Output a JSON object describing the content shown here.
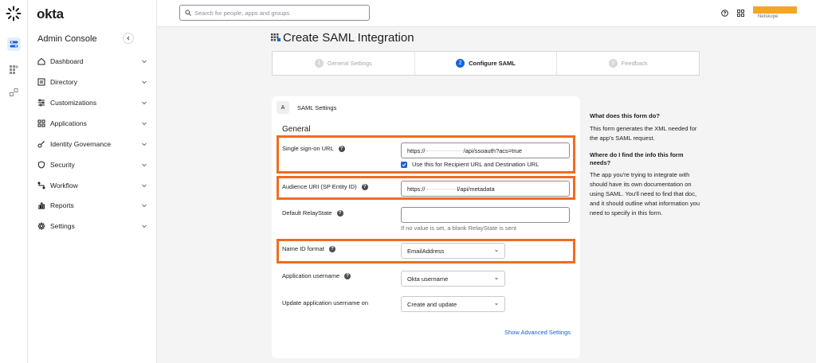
{
  "topbar": {
    "search_placeholder": "Search for people, apps and groups",
    "org_name": "Netskope"
  },
  "sidenav": {
    "brand": "okta",
    "console_title": "Admin Console",
    "items": [
      {
        "label": "Dashboard",
        "icon": "home-icon"
      },
      {
        "label": "Directory",
        "icon": "directory-icon"
      },
      {
        "label": "Customizations",
        "icon": "customizations-icon"
      },
      {
        "label": "Applications",
        "icon": "applications-icon"
      },
      {
        "label": "Identity Governance",
        "icon": "identity-governance-icon"
      },
      {
        "label": "Security",
        "icon": "shield-icon"
      },
      {
        "label": "Workflow",
        "icon": "workflow-icon"
      },
      {
        "label": "Reports",
        "icon": "reports-icon"
      },
      {
        "label": "Settings",
        "icon": "gear-icon"
      }
    ]
  },
  "page": {
    "title": "Create SAML Integration"
  },
  "stepper": {
    "steps": [
      {
        "num": "1",
        "label": "General Settings",
        "active": false
      },
      {
        "num": "2",
        "label": "Configure SAML",
        "active": true
      },
      {
        "num": "3",
        "label": "Feedback",
        "active": false
      }
    ]
  },
  "form": {
    "section_letter": "A",
    "section_title": "SAML Settings",
    "group_title": "General",
    "sso_url_label": "Single sign-on URL",
    "sso_url_prefix": "https://",
    "sso_url_suffix": "/api/ssoauth?acs=true",
    "recipient_checkbox_label": "Use this for Recipient URL and Destination URL",
    "audience_label": "Audience URI (SP Entity ID)",
    "audience_prefix": "https://",
    "audience_suffix": "l/api/metadata",
    "relaystate_label": "Default RelayState",
    "relaystate_value": "",
    "relaystate_hint": "If no value is set, a blank RelayState is sent",
    "nameid_label": "Name ID format",
    "nameid_value": "EmailAddress",
    "app_username_label": "Application username",
    "app_username_value": "Okta username",
    "update_username_label": "Update application username on",
    "update_username_value": "Create and update",
    "advanced_link": "Show Advanced Settings"
  },
  "help": {
    "q1": "What does this form do?",
    "a1": "This form generates the XML needed for the app's SAML request.",
    "q2": "Where do I find the info this form needs?",
    "a2": "The app you're trying to integrate with should have its own documentation on using SAML. You'll need to find that doc, and it should outline what information you need to specify in this form."
  },
  "colors": {
    "accent": "#1662dd",
    "highlight": "#f26b21",
    "org_badge": "#f5a623"
  }
}
